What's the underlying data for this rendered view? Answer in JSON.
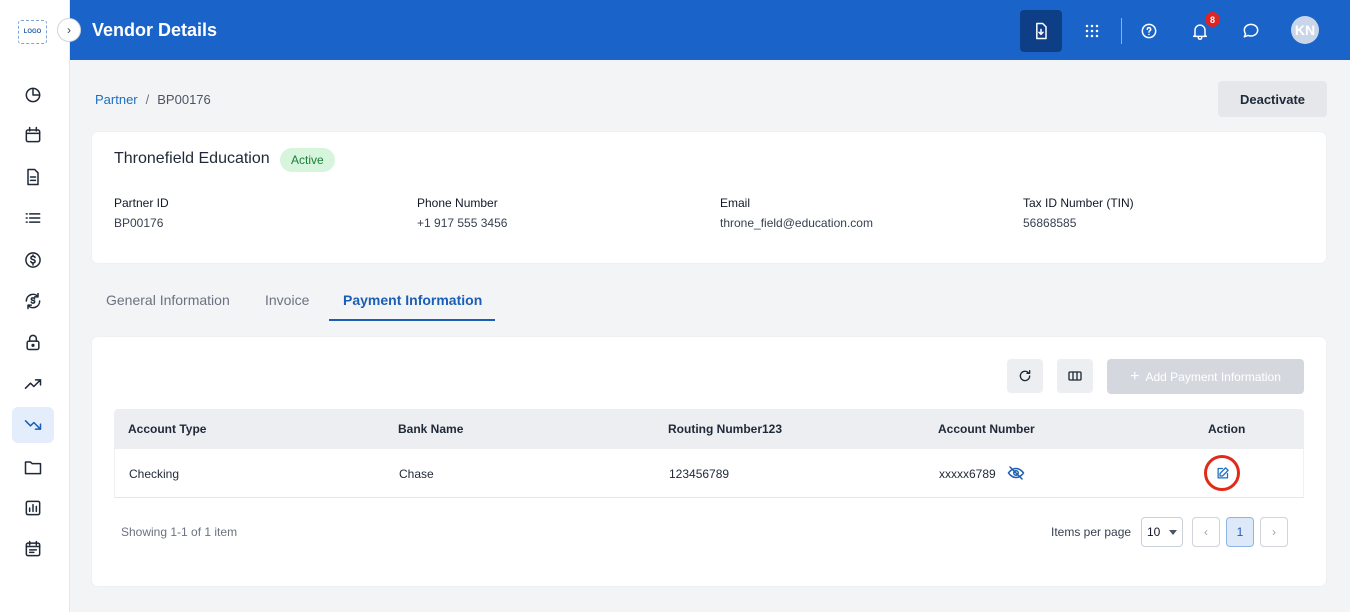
{
  "logo": {
    "text": "LOGO"
  },
  "header": {
    "title": "Vendor Details",
    "notification_count": "8",
    "avatar_initials": "KN"
  },
  "breadcrumb": {
    "parent": "Partner",
    "separator": "/",
    "current": "BP00176"
  },
  "actions": {
    "deactivate_label": "Deactivate"
  },
  "partner": {
    "name": "Thronefield Education",
    "status": "Active",
    "fields": [
      {
        "label": "Partner ID",
        "value": "BP00176"
      },
      {
        "label": "Phone Number",
        "value": "+1 917 555 3456"
      },
      {
        "label": "Email",
        "value": "throne_field@education.com"
      },
      {
        "label": "Tax ID Number (TIN)",
        "value": "56868585"
      }
    ]
  },
  "tabs": [
    {
      "label": "General Information",
      "active": false
    },
    {
      "label": "Invoice",
      "active": false
    },
    {
      "label": "Payment Information",
      "active": true
    }
  ],
  "payment": {
    "add_label": "Add Payment Information",
    "columns": [
      "Account Type",
      "Bank Name",
      "Routing Number123",
      "Account Number",
      "Action"
    ],
    "rows": [
      {
        "account_type": "Checking",
        "bank_name": "Chase",
        "routing_number": "123456789",
        "account_number": "xxxxx6789"
      }
    ],
    "showing_text": "Showing 1-1 of 1 item",
    "items_per_page_label": "Items per page",
    "items_per_page_value": "10",
    "current_page": "1"
  },
  "icons": {
    "sidebar": [
      "dashboard-icon",
      "calendar-icon",
      "document-icon",
      "list-icon",
      "dollar-icon",
      "currency-exchange-icon",
      "lock-icon",
      "trending-up-icon",
      "trending-down-icon",
      "folder-icon",
      "report-icon",
      "schedule-icon"
    ],
    "header": [
      "download-icon",
      "apps-grid-icon",
      "help-icon",
      "bell-icon",
      "chat-icon"
    ]
  },
  "colors": {
    "header_bg": "#1a63c8",
    "accent": "#1b5eb5",
    "status_green": "#1a7f37",
    "highlight_red": "#e12b1a"
  }
}
